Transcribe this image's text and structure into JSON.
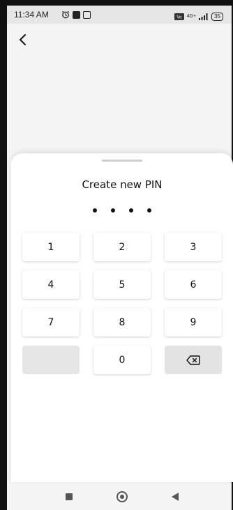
{
  "status_bar": {
    "time": "11:34 AM",
    "battery": "35",
    "network": "4G+",
    "icons": [
      "alarm-icon",
      "notification-icon",
      "sim-icon",
      "volte-icon",
      "signal-icon",
      "battery-icon"
    ]
  },
  "header": {
    "back_icon": "chevron-left-icon"
  },
  "sheet": {
    "title": "Create new PIN",
    "pin_length": 4,
    "keys": [
      "1",
      "2",
      "3",
      "4",
      "5",
      "6",
      "7",
      "8",
      "9",
      "",
      "0",
      ""
    ],
    "backspace_icon": "backspace-icon"
  },
  "nav": {
    "icons": [
      "recent-apps-icon",
      "home-icon",
      "back-icon"
    ]
  }
}
